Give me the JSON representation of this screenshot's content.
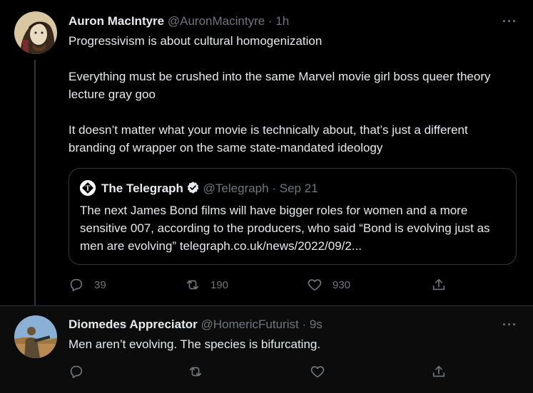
{
  "tweets": [
    {
      "author_name": "Auron MacIntyre",
      "author_handle": "@AuronMacintyre",
      "time": "· 1h",
      "more": "···",
      "paragraphs": [
        "Progressivism is about cultural homogenization",
        "Everything must be crushed into the same Marvel movie girl boss queer theory lecture gray goo",
        "It doesn’t matter what your movie is technically about, that’s just a different branding of wrapper on the same state-mandated ideology"
      ],
      "quote": {
        "author_name": "The Telegraph",
        "author_handle": "@Telegraph",
        "time": "· Sep 21",
        "text": "The next James Bond films will have bigger roles for women and a more sensitive 007, according to the producers, who said “Bond is evolving just as men are evolving” telegraph.co.uk/news/2022/09/2..."
      },
      "actions": {
        "replies": "39",
        "retweets": "190",
        "likes": "930"
      }
    },
    {
      "author_name": "Diomedes Appreciator",
      "author_handle": "@HomericFuturist",
      "time": "· 9s",
      "more": "···",
      "text": "Men aren’t evolving. The species is bifurcating."
    }
  ],
  "colors": {
    "background": "#000000",
    "text": "#e7e9ea",
    "muted": "#71767b",
    "border": "#333639"
  },
  "icons": [
    "reply-icon",
    "retweet-icon",
    "like-icon",
    "share-icon",
    "verified-badge-icon",
    "more-icon"
  ]
}
